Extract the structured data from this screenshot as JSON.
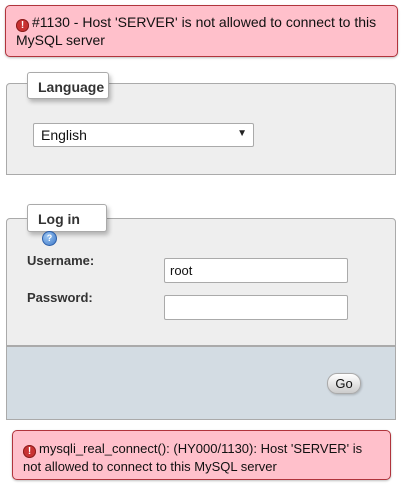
{
  "errors": {
    "top": "#1130 - Host 'SERVER' is not allowed to connect to this MySQL server",
    "bottom": "mysqli_real_connect(): (HY000/1130): Host 'SERVER' is not allowed to connect to this MySQL server"
  },
  "icons": {
    "error": "error-icon",
    "help": "help-icon"
  },
  "language": {
    "legend": "Language",
    "selected": "English"
  },
  "login": {
    "legend": "Log in",
    "username_label": "Username:",
    "username_value": "root",
    "password_label": "Password:",
    "password_value": "",
    "go_label": "Go"
  },
  "colors": {
    "error_bg": "#ffc0cb",
    "error_border": "#b0343c",
    "panel_bg": "#eeeeee",
    "footer_bg": "#d3dce3"
  }
}
